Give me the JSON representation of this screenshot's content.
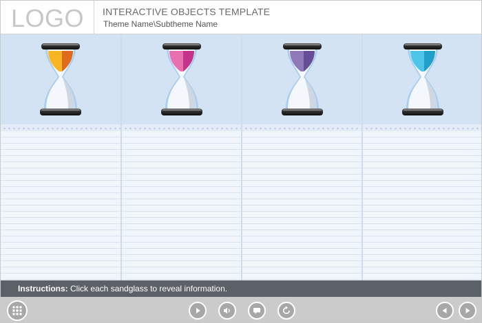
{
  "header": {
    "logo": "LOGO",
    "title": "INTERACTIVE OBJECTS TEMPLATE",
    "subtitle": "Theme Name\\Subtheme Name"
  },
  "sandglasses": [
    {
      "name": "sandglass-orange",
      "colors": {
        "light": "#f9b523",
        "dark": "#e06b1c"
      }
    },
    {
      "name": "sandglass-pink",
      "colors": {
        "light": "#e870b0",
        "dark": "#c4348a"
      }
    },
    {
      "name": "sandglass-purple",
      "colors": {
        "light": "#9079b8",
        "dark": "#674c98"
      }
    },
    {
      "name": "sandglass-cyan",
      "colors": {
        "light": "#4cc5e8",
        "dark": "#1f9fc9"
      }
    }
  ],
  "instructions": {
    "label": "Instructions:",
    "text": " Click each sandglass to reveal information."
  },
  "player": {
    "buttons": [
      "menu-icon",
      "play-icon",
      "volume-icon",
      "caption-icon",
      "replay-icon",
      "previous-icon",
      "next-icon"
    ]
  }
}
